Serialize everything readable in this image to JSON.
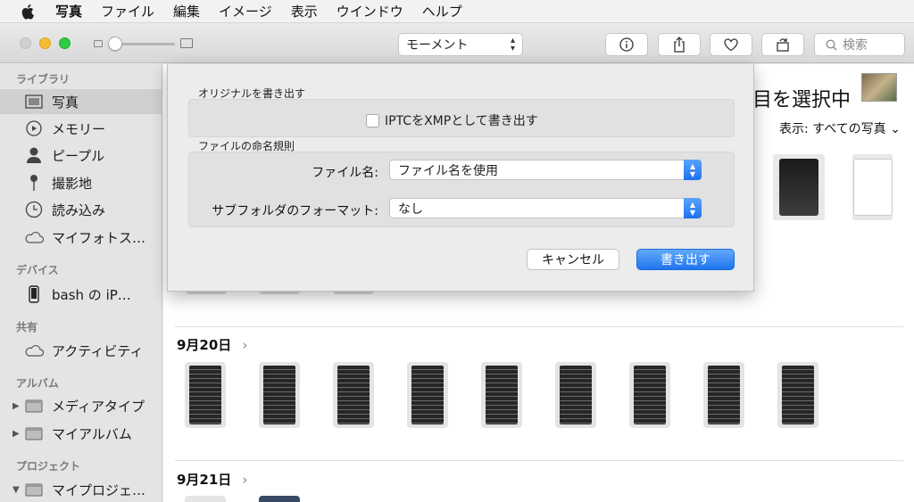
{
  "menubar": {
    "items": [
      "写真",
      "ファイル",
      "編集",
      "イメージ",
      "表示",
      "ウインドウ",
      "ヘルプ"
    ]
  },
  "toolbar": {
    "moment_select": "モーメント",
    "search_placeholder": "検索"
  },
  "sidebar": {
    "sections": [
      {
        "header": "ライブラリ",
        "items": [
          "写真",
          "メモリー",
          "ピープル",
          "撮影地",
          "読み込み",
          "マイフォトス…"
        ]
      },
      {
        "header": "デバイス",
        "items": [
          "bash の iP…"
        ]
      },
      {
        "header": "共有",
        "items": [
          "アクティビティ"
        ]
      },
      {
        "header": "アルバム",
        "items": [
          "メディアタイプ",
          "マイアルバム"
        ]
      },
      {
        "header": "プロジェクト",
        "items": [
          "マイプロジェ…"
        ]
      }
    ]
  },
  "main": {
    "headline": "目を選択中",
    "view_label": "表示:",
    "view_value": "すべての写真",
    "dates": [
      "9月20日",
      "9月21日"
    ]
  },
  "dialog": {
    "section1": "オリジナルを書き出す",
    "checkbox_label": "IPTCをXMPとして書き出す",
    "section2": "ファイルの命名規則",
    "filename_label": "ファイル名:",
    "filename_value": "ファイル名を使用",
    "subfolder_label": "サブフォルダのフォーマット:",
    "subfolder_value": "なし",
    "cancel": "キャンセル",
    "export": "書き出す"
  }
}
